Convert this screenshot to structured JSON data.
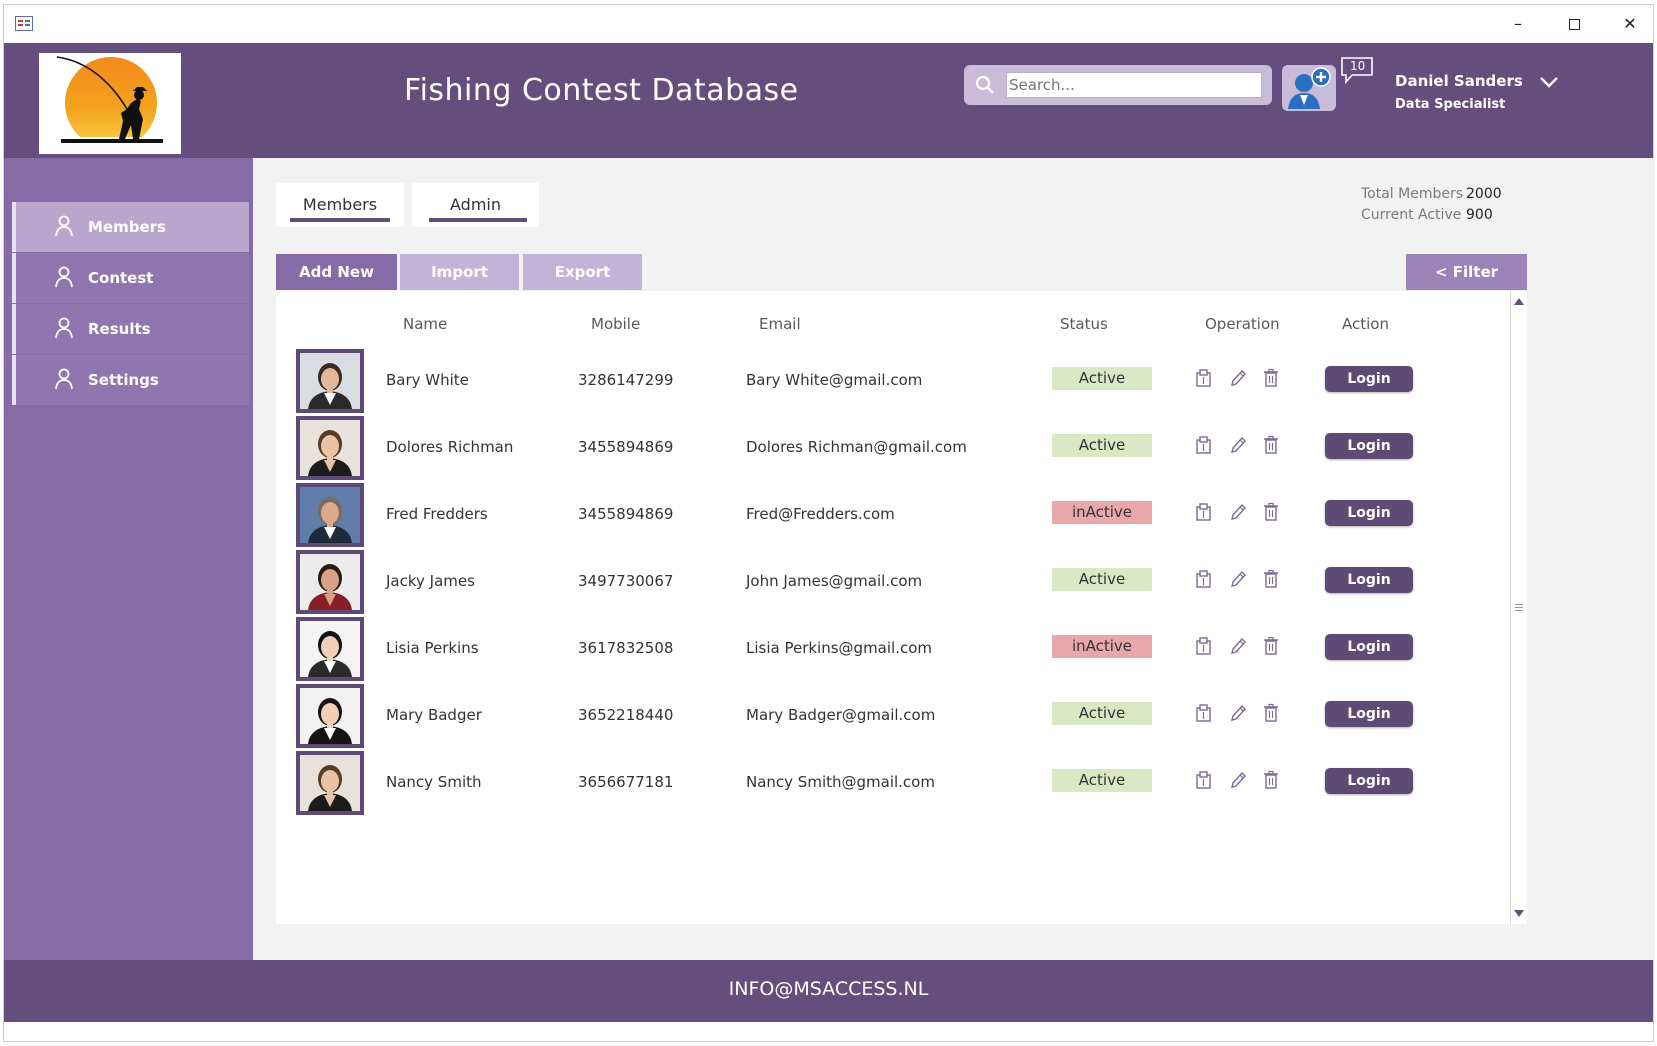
{
  "header": {
    "title": "Fishing Contest Database",
    "search_placeholder": "Search...",
    "notification_count": "10",
    "user_name": "Daniel Sanders",
    "user_role": "Data Specialist"
  },
  "sidebar": {
    "items": [
      {
        "label": "Members",
        "active": true
      },
      {
        "label": "Contest",
        "active": false
      },
      {
        "label": "Results",
        "active": false
      },
      {
        "label": "Settings",
        "active": false
      }
    ]
  },
  "tabs": [
    "Members",
    "Admin"
  ],
  "stats": {
    "total_label": "Total Members",
    "total_value": "2000",
    "active_label": "Current Active",
    "active_value": "900"
  },
  "toolbar": {
    "add_new": "Add New",
    "import": "Import",
    "export": "Export",
    "filter": "< Filter"
  },
  "table": {
    "columns": [
      "Name",
      "Mobile",
      "Email",
      "Status",
      "Operation",
      "Action"
    ],
    "action_label": "Login",
    "rows": [
      {
        "name": "Bary White",
        "mobile": "3286147299",
        "email": "Bary White@gmail.com",
        "status": "Active"
      },
      {
        "name": "Dolores Richman",
        "mobile": "3455894869",
        "email": "Dolores Richman@gmail.com",
        "status": "Active"
      },
      {
        "name": "Fred Fredders",
        "mobile": "3455894869",
        "email": "Fred@Fredders.com",
        "status": "inActive"
      },
      {
        "name": "Jacky  James",
        "mobile": "3497730067",
        "email": "John James@gmail.com",
        "status": "Active"
      },
      {
        "name": "Lisia  Perkins",
        "mobile": "3617832508",
        "email": "Lisia Perkins@gmail.com",
        "status": "inActive"
      },
      {
        "name": "Mary  Badger",
        "mobile": "3652218440",
        "email": "Mary Badger@gmail.com",
        "status": "Active"
      },
      {
        "name": "Nancy Smith",
        "mobile": "3656677181",
        "email": "Nancy Smith@gmail.com",
        "status": "Active"
      }
    ]
  },
  "footer": {
    "text": "INFO@MSACCESS.NL"
  },
  "colors": {
    "header": "#634e7d",
    "sidebar": "#866ca7",
    "active_status": "#d9e7c4",
    "inactive_status": "#e8a7aa",
    "login_button": "#5d4a75"
  }
}
